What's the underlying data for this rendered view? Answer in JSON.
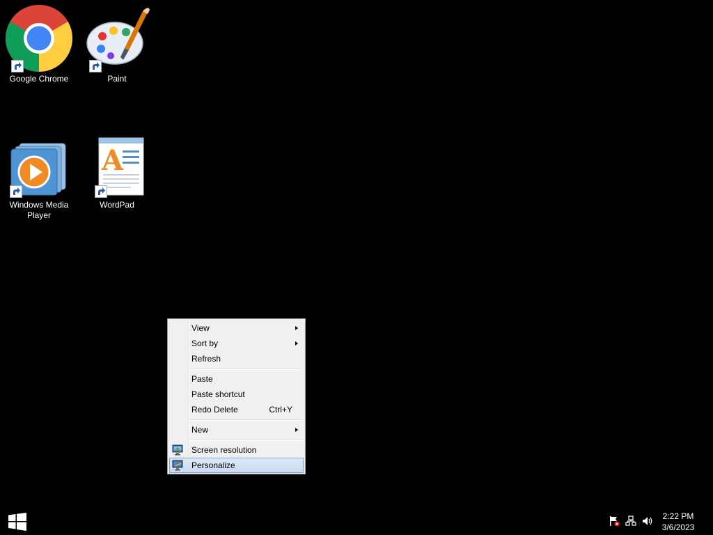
{
  "desktop": {
    "icons": [
      {
        "label": "Google Chrome",
        "icon": "chrome-icon"
      },
      {
        "label": "Paint",
        "icon": "paint-icon"
      },
      {
        "label": "Windows Media Player",
        "icon": "media-player-icon"
      },
      {
        "label": "WordPad",
        "icon": "wordpad-icon"
      }
    ]
  },
  "context_menu": {
    "items": [
      {
        "label": "View",
        "submenu": true
      },
      {
        "label": "Sort by",
        "submenu": true
      },
      {
        "label": "Refresh"
      },
      {
        "label": "Paste"
      },
      {
        "label": "Paste shortcut"
      },
      {
        "label": "Redo Delete",
        "shortcut": "Ctrl+Y"
      },
      {
        "label": "New",
        "submenu": true
      },
      {
        "label": "Screen resolution",
        "icon": "screen-resolution-icon"
      },
      {
        "label": "Personalize",
        "icon": "personalize-icon",
        "highlighted": true
      }
    ]
  },
  "taskbar": {
    "start": "windows-logo-icon",
    "tray": [
      "action-center-flag-icon",
      "network-icon",
      "volume-icon"
    ],
    "clock": {
      "time": "2:22 PM",
      "date": "3/6/2023"
    }
  },
  "colors": {
    "desktop_bg": "#000000",
    "menu_bg": "#f0f0f0",
    "menu_highlight": "#cfe0f3",
    "menu_highlight_border": "#7da2ce"
  }
}
